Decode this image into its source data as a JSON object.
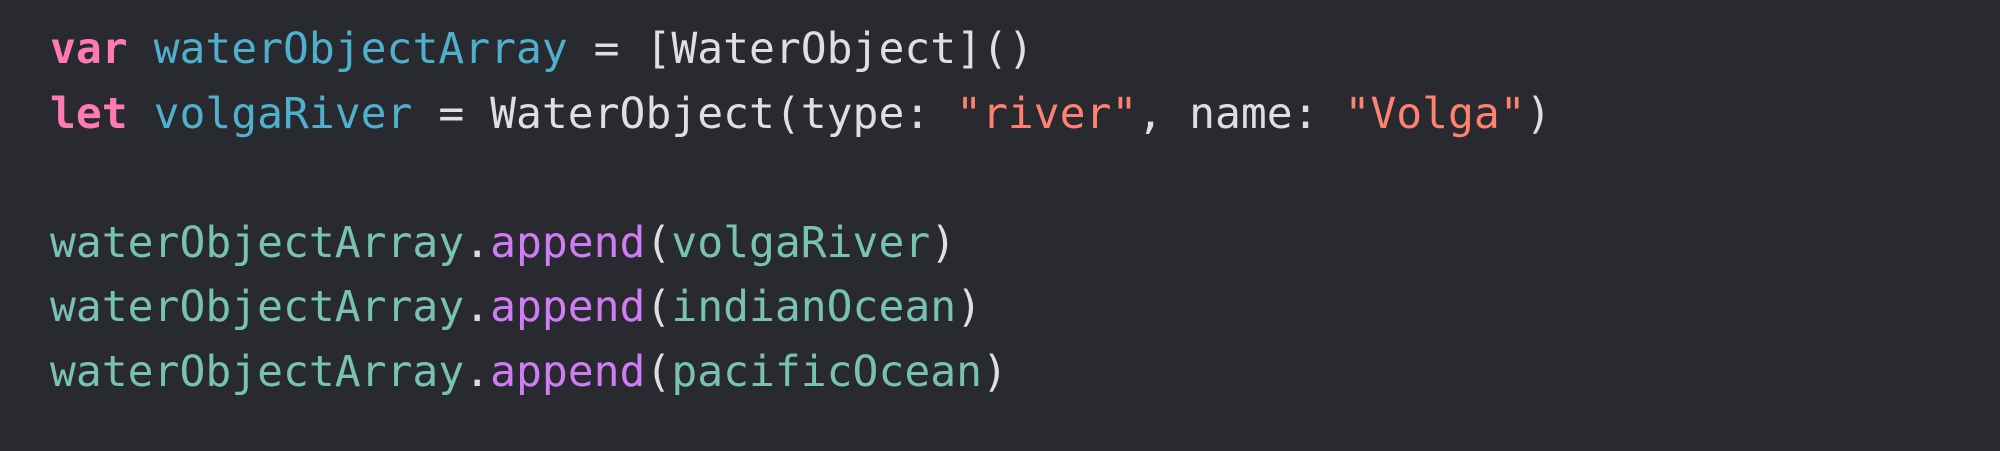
{
  "colors": {
    "background": "#292a30",
    "keyword": "#ff7ab2",
    "declaration": "#4eb0cc",
    "reference": "#78c2b3",
    "method": "#d07df5",
    "string": "#ff8170",
    "plain": "#dfdfe0"
  },
  "code": {
    "line1": {
      "keyword": "var",
      "name": "waterObjectArray",
      "rest": " = [WaterObject]()"
    },
    "line2": {
      "keyword": "let",
      "name": "volgaRiver",
      "part1": " = WaterObject(type: ",
      "str1": "\"river\"",
      "part2": ", name: ",
      "str2": "\"Volga\"",
      "part3": ")"
    },
    "line4": {
      "object": "waterObjectArray",
      "dot": ".",
      "method": "append",
      "open": "(",
      "arg": "volgaRiver",
      "close": ")"
    },
    "line5": {
      "object": "waterObjectArray",
      "dot": ".",
      "method": "append",
      "open": "(",
      "arg": "indianOcean",
      "close": ")"
    },
    "line6": {
      "object": "waterObjectArray",
      "dot": ".",
      "method": "append",
      "open": "(",
      "arg": "pacificOcean",
      "close": ")"
    }
  }
}
